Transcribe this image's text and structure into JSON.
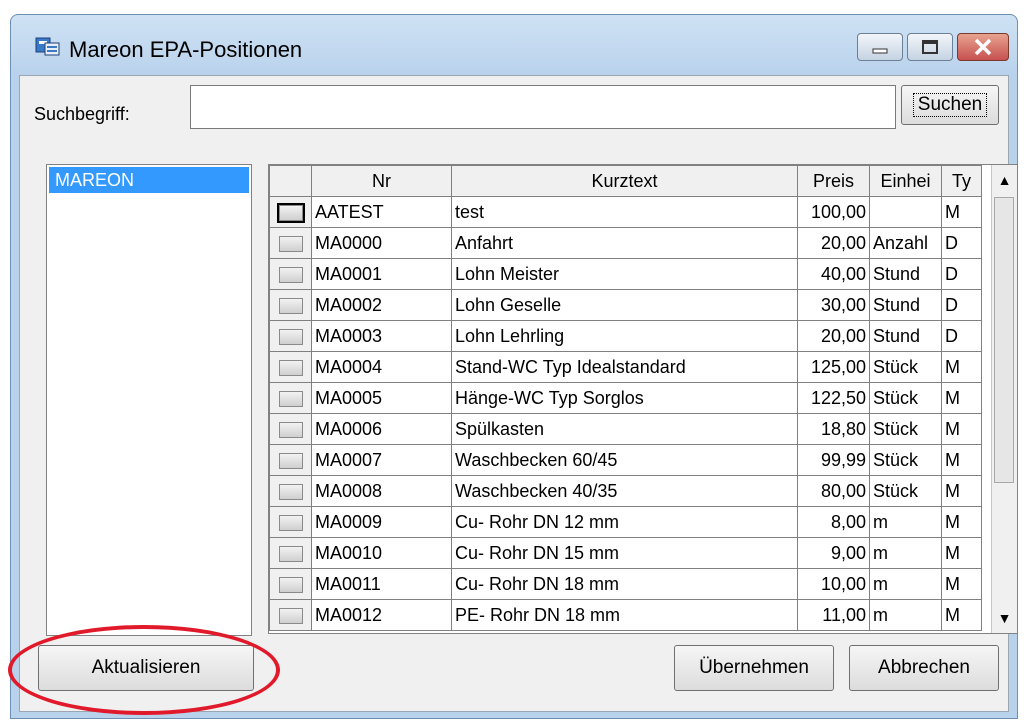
{
  "window": {
    "title": "Mareon EPA-Positionen"
  },
  "search": {
    "label": "Suchbegriff:",
    "value": "",
    "button": "Suchen"
  },
  "catalogs": [
    {
      "label": "MAREON",
      "selected": true
    }
  ],
  "table": {
    "columns": [
      "Nr",
      "Kurztext",
      "Preis",
      "Einhei",
      "Ty"
    ],
    "rows": [
      {
        "nr": "AATEST",
        "kurztext": "test",
        "preis": "100,00",
        "einheit": "",
        "typ": "M"
      },
      {
        "nr": "MA0000",
        "kurztext": "Anfahrt",
        "preis": "20,00",
        "einheit": "Anzahl",
        "typ": "D"
      },
      {
        "nr": "MA0001",
        "kurztext": "Lohn Meister",
        "preis": "40,00",
        "einheit": "Stund",
        "typ": "D"
      },
      {
        "nr": "MA0002",
        "kurztext": "Lohn Geselle",
        "preis": "30,00",
        "einheit": "Stund",
        "typ": "D"
      },
      {
        "nr": "MA0003",
        "kurztext": "Lohn Lehrling",
        "preis": "20,00",
        "einheit": "Stund",
        "typ": "D"
      },
      {
        "nr": "MA0004",
        "kurztext": "Stand-WC Typ Idealstandard",
        "preis": "125,00",
        "einheit": "Stück",
        "typ": "M"
      },
      {
        "nr": "MA0005",
        "kurztext": "Hänge-WC Typ Sorglos",
        "preis": "122,50",
        "einheit": "Stück",
        "typ": "M"
      },
      {
        "nr": "MA0006",
        "kurztext": "Spülkasten",
        "preis": "18,80",
        "einheit": "Stück",
        "typ": "M"
      },
      {
        "nr": "MA0007",
        "kurztext": "Waschbecken 60/45",
        "preis": "99,99",
        "einheit": "Stück",
        "typ": "M"
      },
      {
        "nr": "MA0008",
        "kurztext": "Waschbecken 40/35",
        "preis": "80,00",
        "einheit": "Stück",
        "typ": "M"
      },
      {
        "nr": "MA0009",
        "kurztext": "Cu- Rohr DN 12 mm",
        "preis": "8,00",
        "einheit": "m",
        "typ": "M"
      },
      {
        "nr": "MA0010",
        "kurztext": "Cu- Rohr DN 15 mm",
        "preis": "9,00",
        "einheit": "m",
        "typ": "M"
      },
      {
        "nr": "MA0011",
        "kurztext": "Cu- Rohr DN 18 mm",
        "preis": "10,00",
        "einheit": "m",
        "typ": "M"
      },
      {
        "nr": "MA0012",
        "kurztext": "PE- Rohr DN 18 mm",
        "preis": "11,00",
        "einheit": "m",
        "typ": "M"
      }
    ]
  },
  "buttons": {
    "refresh": "Aktualisieren",
    "accept": "Übernehmen",
    "cancel": "Abbrechen"
  },
  "colors": {
    "selection": "#3399ff",
    "annotation": "#e01a2a",
    "close": "#c75050"
  }
}
